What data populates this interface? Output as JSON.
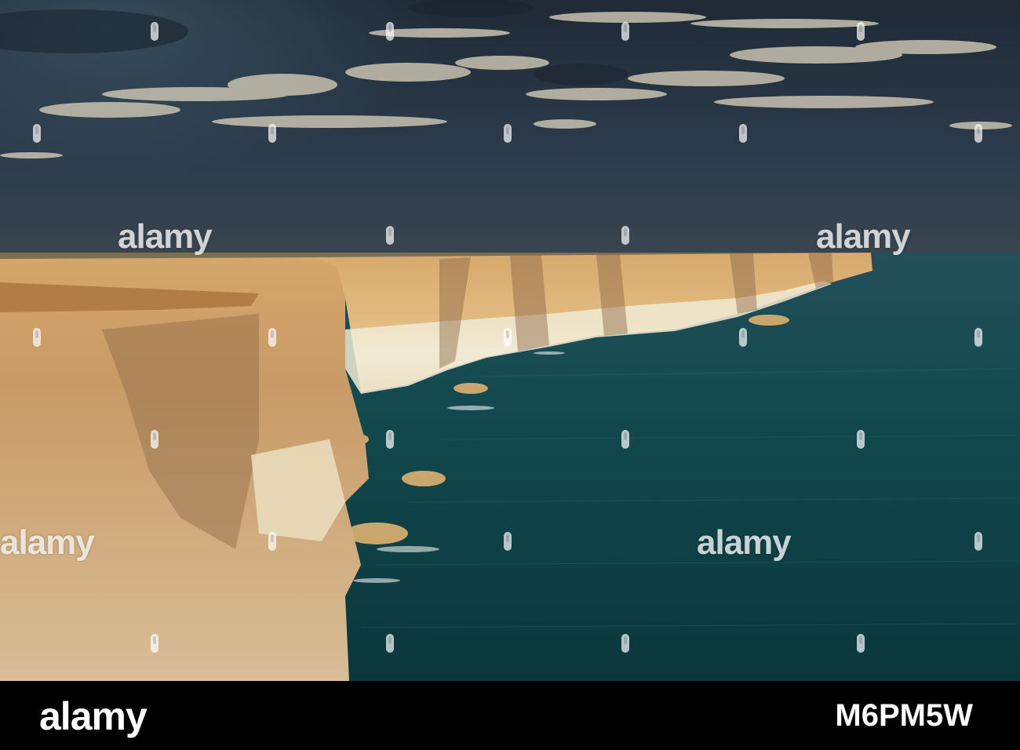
{
  "photo": {
    "colors": {
      "sky_top": "#1f2a36",
      "sky_mid": "#2a3a4a",
      "horizon": "#2f3c48",
      "sea_far": "#1f4f58",
      "sea_near": "#0c3b40",
      "cliff_light": "#e8c48a",
      "cliff_shadow": "#a9805a",
      "cliff_white": "#f1ead4",
      "cloud": "#c9c3b3"
    },
    "watermark_marks": 15
  },
  "watermarks": {
    "text": "alamy"
  },
  "footer": {
    "logo": "alamy",
    "image_id": "M6PM5W"
  }
}
